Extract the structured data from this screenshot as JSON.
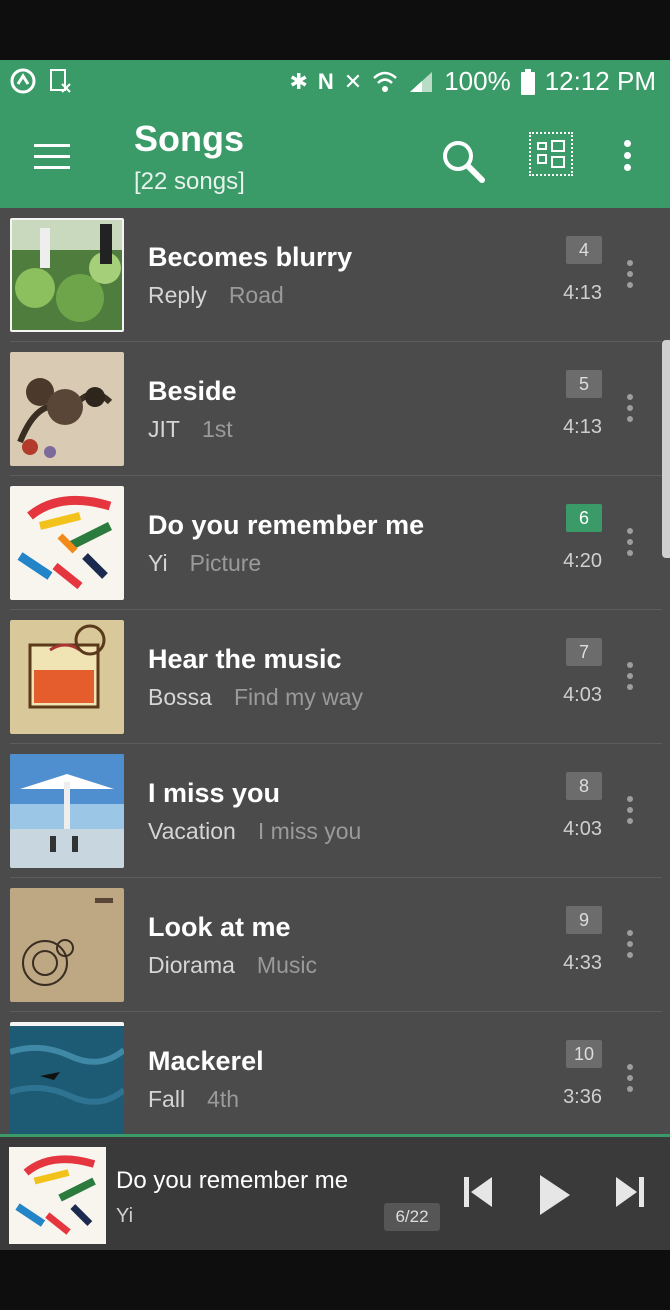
{
  "status_bar": {
    "battery": "100%",
    "time": "12:12 PM"
  },
  "header": {
    "title": "Songs",
    "subtitle": "[22 songs]"
  },
  "colors": {
    "accent": "#3b9b68",
    "list_bg": "#4a4b4a",
    "player_bg": "#393a39"
  },
  "songs": [
    {
      "title": "Becomes blurry",
      "artist": "Reply",
      "album": "Road",
      "track": "4",
      "duration": "4:13",
      "active": false
    },
    {
      "title": "Beside",
      "artist": "JIT",
      "album": "1st",
      "track": "5",
      "duration": "4:13",
      "active": false
    },
    {
      "title": "Do you remember me",
      "artist": "Yi",
      "album": "Picture",
      "track": "6",
      "duration": "4:20",
      "active": true
    },
    {
      "title": "Hear the music",
      "artist": "Bossa",
      "album": "Find my way",
      "track": "7",
      "duration": "4:03",
      "active": false
    },
    {
      "title": "I miss you",
      "artist": "Vacation",
      "album": "I miss you",
      "track": "8",
      "duration": "4:03",
      "active": false
    },
    {
      "title": "Look at me",
      "artist": "Diorama",
      "album": "Music",
      "track": "9",
      "duration": "4:33",
      "active": false
    },
    {
      "title": "Mackerel",
      "artist": "Fall",
      "album": "4th",
      "track": "10",
      "duration": "3:36",
      "active": false
    }
  ],
  "player": {
    "title": "Do you remember me",
    "artist": "Yi",
    "position": "6/22"
  },
  "icons": [
    "menu-icon",
    "search-icon",
    "grid-view-icon",
    "more-vert-icon",
    "previous-icon",
    "play-icon",
    "next-icon"
  ]
}
